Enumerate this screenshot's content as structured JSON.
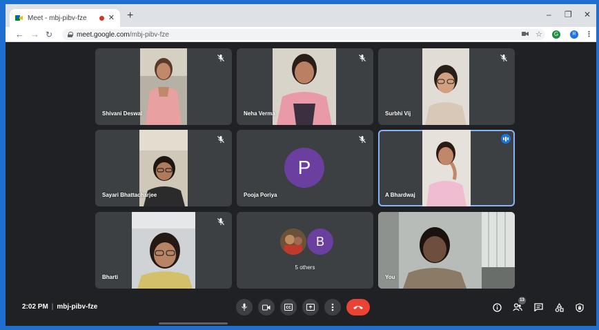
{
  "browser": {
    "tab_title": "Meet - mbj-pibv-fze",
    "tab_close": "✕",
    "new_tab": "+",
    "url_host": "meet.google.com",
    "url_path": "/mbj-pibv-fze",
    "window_minimize": "–",
    "window_restore": "❐",
    "window_close": "✕",
    "profile_initial": "R",
    "extension_label": "G"
  },
  "participants": [
    {
      "name": "Shivani Deswal",
      "muted": true,
      "shirt": "#e8a0a0",
      "wall": "#b7b0a4"
    },
    {
      "name": "Neha Verma",
      "muted": true,
      "shirt": "#e89aa8",
      "wall": "#d9d4c9"
    },
    {
      "name": "Surbhi Vij",
      "muted": true,
      "shirt": "#d8c8b8",
      "wall": "#e1ddd6"
    },
    {
      "name": "Sayari Bhattacharjee",
      "muted": true,
      "shirt": "#2b2b2b",
      "wall": "#cfc7b8"
    },
    {
      "name": "Pooja Poriya",
      "muted": true,
      "avatar_letter": "P"
    },
    {
      "name": "A Bhardwaj",
      "muted": false,
      "speaking": true,
      "shirt": "#f0bcd0",
      "wall": "#e6e1da"
    },
    {
      "name": "Bharti",
      "muted": true,
      "shirt": "#d4c06a",
      "wall": "#cfd3d6"
    },
    {
      "name": "5 others",
      "muted": false,
      "avatar_letter": "B"
    },
    {
      "name": "You",
      "muted": false,
      "shirt": "#8a7a66",
      "wall": "#b8bcb8"
    }
  ],
  "bottom_bar": {
    "time": "2:02 PM",
    "separator": "|",
    "meeting_code": "mbj-pibv-fze",
    "participant_count": "13"
  },
  "colors": {
    "background": "#202124",
    "tile": "#3c4043",
    "accent": "#1a73e8",
    "end_call": "#ea4335",
    "avatar": "#6b3fa0"
  },
  "icons": [
    "mic-icon",
    "camera-icon",
    "captions-icon",
    "present-icon",
    "more-options-icon",
    "end-call-icon",
    "info-icon",
    "people-icon",
    "chat-icon",
    "activities-icon",
    "host-controls-icon"
  ]
}
